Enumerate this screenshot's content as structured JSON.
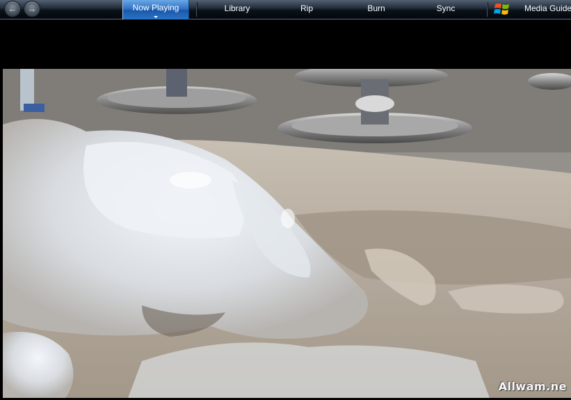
{
  "navbar": {
    "back_icon": "back-arrow-icon",
    "forward_icon": "forward-arrow-icon",
    "tabs": [
      {
        "label": "Now Playing",
        "active": true
      },
      {
        "label": "Library",
        "active": false
      },
      {
        "label": "Rip",
        "active": false
      },
      {
        "label": "Burn",
        "active": false
      },
      {
        "label": "Sync",
        "active": false
      },
      {
        "label": "Media Guide",
        "active": false
      }
    ],
    "active_color": "#2d6fc1",
    "bar_color": "#0b1119"
  },
  "video": {
    "watermark": "Allwam.ne"
  }
}
